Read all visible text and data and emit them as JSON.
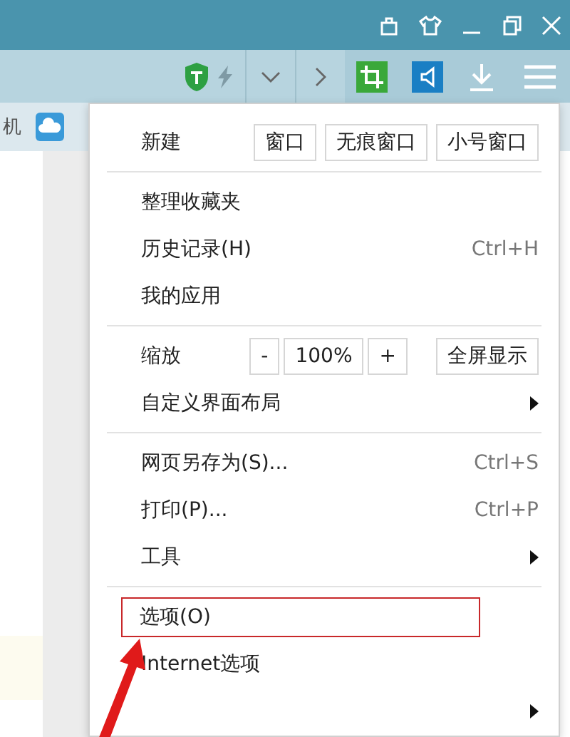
{
  "bookmarks_bar": {
    "items": [
      {
        "label": "机"
      },
      {
        "kind": "cloud"
      }
    ]
  },
  "menu": {
    "rows": [
      {
        "kind": "buttons",
        "label": "新建",
        "buttons": [
          "窗口",
          "无痕窗口",
          "小号窗口"
        ]
      },
      {
        "kind": "separator"
      },
      {
        "kind": "item",
        "label": "整理收藏夹",
        "submenu": false,
        "highlighted": false
      },
      {
        "kind": "item",
        "label": "历史记录(H)",
        "shortcut": "Ctrl+H",
        "submenu": false,
        "highlighted": false
      },
      {
        "kind": "item",
        "label": "我的应用",
        "submenu": false,
        "highlighted": false
      },
      {
        "kind": "separator"
      },
      {
        "kind": "zoom",
        "label": "缩放",
        "minus": "-",
        "value": "100%",
        "plus": "+",
        "fullscreen": "全屏显示"
      },
      {
        "kind": "item",
        "label": "自定义界面布局",
        "submenu": true,
        "highlighted": false
      },
      {
        "kind": "separator"
      },
      {
        "kind": "item",
        "label": "网页另存为(S)...",
        "shortcut": "Ctrl+S",
        "submenu": false,
        "highlighted": false
      },
      {
        "kind": "item",
        "label": "打印(P)...",
        "shortcut": "Ctrl+P",
        "submenu": false,
        "highlighted": false
      },
      {
        "kind": "item",
        "label": "工具",
        "submenu": true,
        "highlighted": false
      },
      {
        "kind": "separator"
      },
      {
        "kind": "item",
        "label": "选项(O)",
        "submenu": false,
        "highlighted": true
      },
      {
        "kind": "item",
        "label": "Internet选项",
        "submenu": false,
        "highlighted": false
      },
      {
        "kind": "item",
        "submenu": true
      }
    ]
  }
}
